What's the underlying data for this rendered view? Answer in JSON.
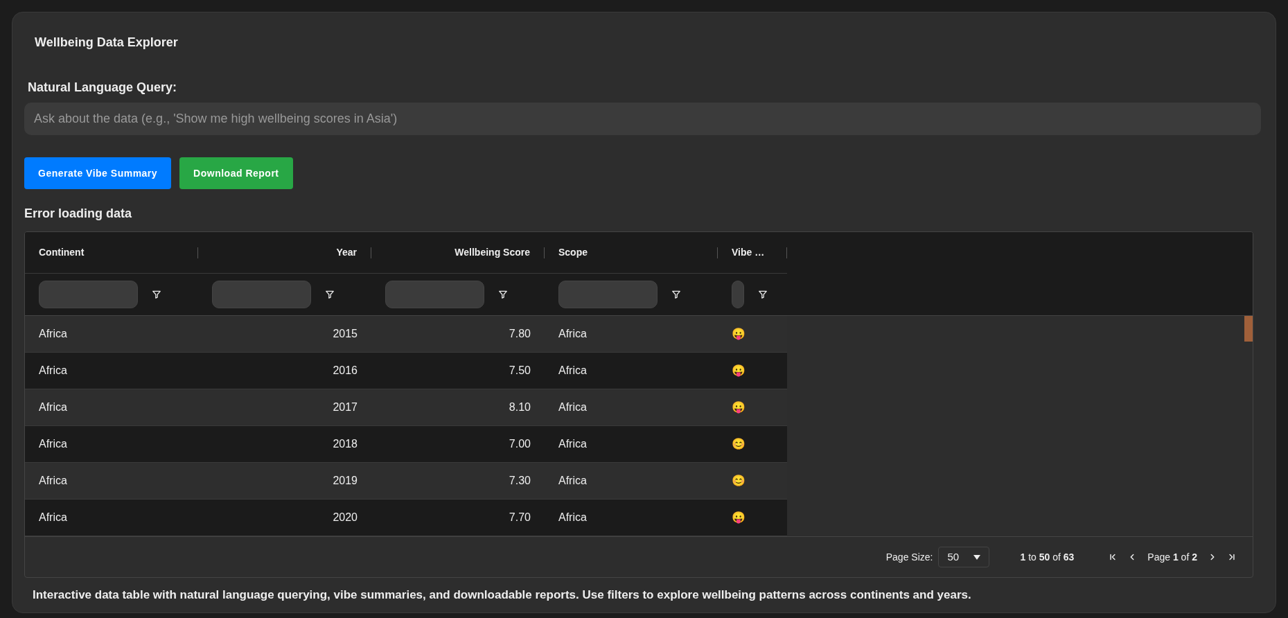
{
  "title": "Wellbeing Data Explorer",
  "query": {
    "label": "Natural Language Query:",
    "placeholder": "Ask about the data (e.g., 'Show me high wellbeing scores in Asia')"
  },
  "buttons": [
    {
      "label": "Generate Vibe Summary",
      "kind": "primary"
    },
    {
      "label": "Download Report",
      "kind": "success"
    }
  ],
  "status": "Error loading data",
  "table": {
    "columns": [
      {
        "label": "Continent",
        "kind": "text"
      },
      {
        "label": "Year",
        "kind": "number"
      },
      {
        "label": "Wellbeing Score",
        "kind": "number"
      },
      {
        "label": "Scope",
        "kind": "text"
      },
      {
        "label": "Vibe …",
        "kind": "emoji"
      }
    ],
    "rows": [
      [
        "Africa",
        "2015",
        "7.80",
        "Africa",
        "😛"
      ],
      [
        "Africa",
        "2016",
        "7.50",
        "Africa",
        "😛"
      ],
      [
        "Africa",
        "2017",
        "8.10",
        "Africa",
        "😛"
      ],
      [
        "Africa",
        "2018",
        "7.00",
        "Africa",
        "😊"
      ],
      [
        "Africa",
        "2019",
        "7.30",
        "Africa",
        "😊"
      ],
      [
        "Africa",
        "2020",
        "7.70",
        "Africa",
        "😛"
      ]
    ],
    "pagination": {
      "page_size_label": "Page Size:",
      "page_size": "50",
      "range": "**1** to **50** of **63**",
      "page": "Page **1** of **2**"
    }
  },
  "description": "Interactive data table with natural language querying, vibe summaries, and downloadable reports. Use filters to explore wellbeing patterns across continents and years."
}
